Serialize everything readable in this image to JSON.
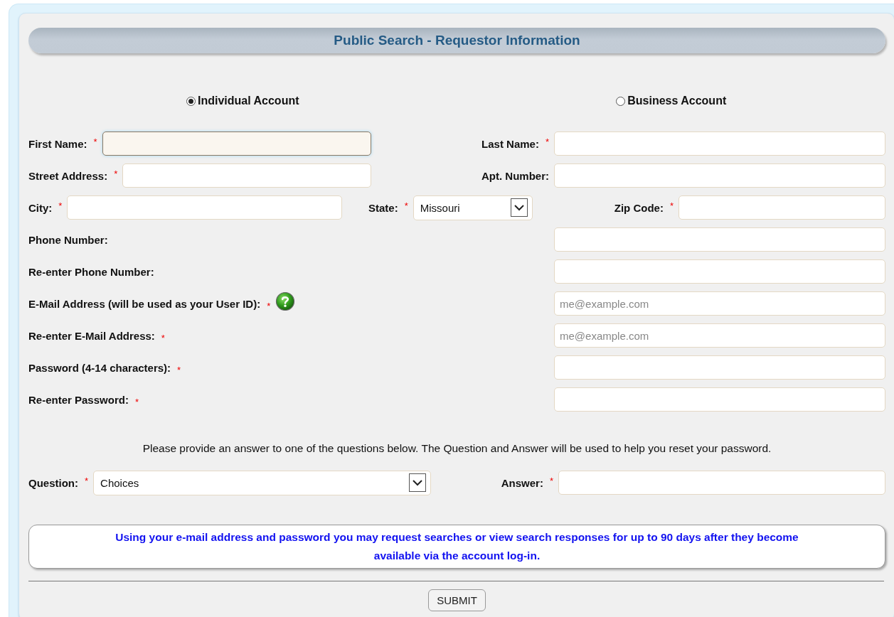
{
  "header": {
    "title": "Public Search - Requestor Information"
  },
  "required_mark": "*",
  "account_types": [
    {
      "label": "Individual Account",
      "selected": true
    },
    {
      "label": "Business Account",
      "selected": false
    }
  ],
  "address_rows": [
    [
      {
        "kind": "text",
        "label": "First Name:",
        "required": true,
        "focused": true
      },
      {
        "kind": "text",
        "label": "Last Name:",
        "required": true,
        "focused": false
      }
    ],
    [
      {
        "kind": "text",
        "label": "Street Address:",
        "required": true,
        "focused": false
      },
      {
        "kind": "text",
        "label": "Apt. Number:",
        "required": false,
        "focused": false
      }
    ],
    [
      {
        "kind": "text",
        "label": "City:",
        "required": true,
        "focused": false
      },
      {
        "kind": "select",
        "label": "State:",
        "required": true,
        "value": "Missouri"
      },
      {
        "kind": "text",
        "label": "Zip Code:",
        "required": true,
        "focused": false
      }
    ]
  ],
  "contact_fields": [
    {
      "label": "Phone Number:",
      "required": false,
      "help": false
    },
    {
      "label": "Re-enter Phone Number:",
      "required": false,
      "help": false
    },
    {
      "label": "E-Mail Address (will be used as your User ID):",
      "required": true,
      "help": true,
      "placeholder": "me@example.com"
    },
    {
      "label": "Re-enter E-Mail Address:",
      "required": true,
      "help": false,
      "placeholder": "me@example.com"
    },
    {
      "label": "Password (4-14 characters):",
      "required": true,
      "help": false
    },
    {
      "label": "Re-enter Password:",
      "required": true,
      "help": false
    }
  ],
  "security_note": "Please provide an answer to one of the questions below. The Question and Answer will be used to help you reset your password.",
  "question": {
    "label": "Question:",
    "required": true,
    "value": "Choices"
  },
  "answer": {
    "label": "Answer:",
    "required": true
  },
  "info_message": "Using your e-mail address and password you may request searches or view search responses for up to 90 days after they become available via the account log-in.",
  "submit": {
    "label": "SUBMIT"
  }
}
